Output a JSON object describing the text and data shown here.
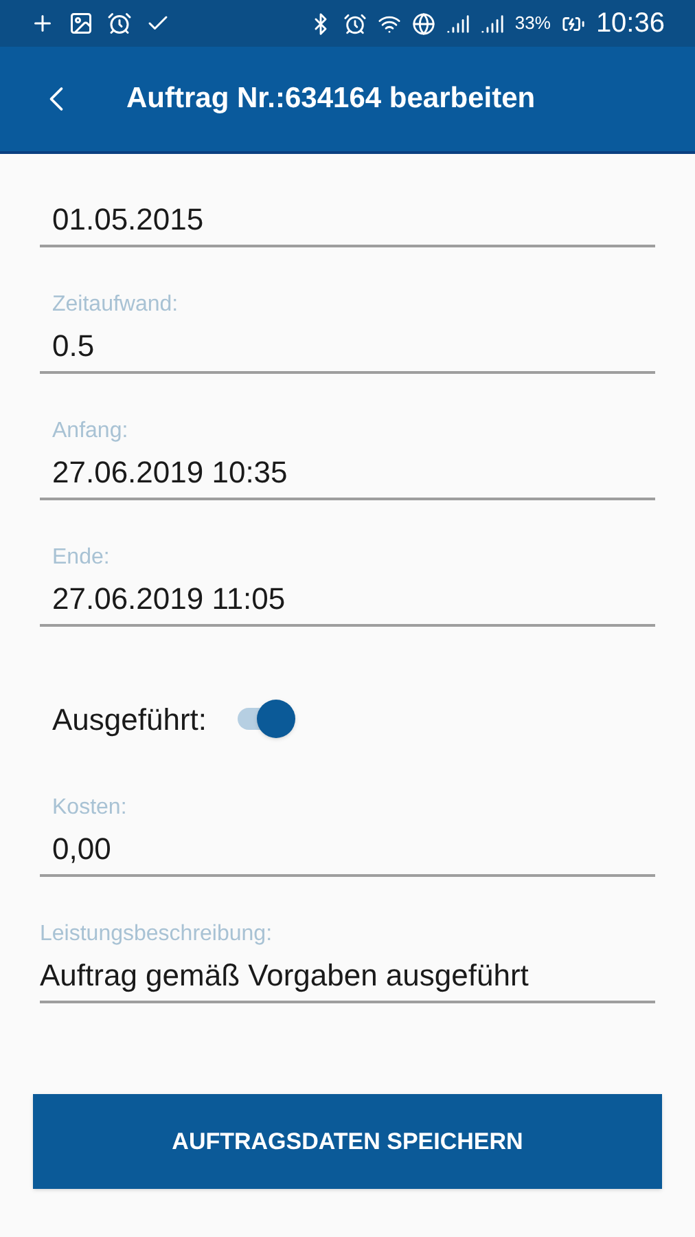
{
  "status_bar": {
    "battery": "33%",
    "time": "10:36"
  },
  "header": {
    "title": "Auftrag Nr.:634164 bearbeiten"
  },
  "form": [
    {
      "kind": "field",
      "value": "01.05.2015",
      "wide": false
    },
    {
      "kind": "field",
      "label": "Zeitaufwand:",
      "value": "0.5",
      "wide": false
    },
    {
      "kind": "field",
      "label": "Anfang:",
      "value": "27.06.2019 10:35",
      "wide": false
    },
    {
      "kind": "field",
      "label": "Ende:",
      "value": "27.06.2019 11:05",
      "wide": false
    },
    {
      "kind": "switch",
      "label": "Ausgeführt:",
      "on": true
    },
    {
      "kind": "field",
      "label": "Kosten:",
      "value": "0,00",
      "wide": false
    },
    {
      "kind": "field",
      "label": "Leistungsbeschreibung:",
      "value": "Auftrag gemäß Vorgaben ausgeführt",
      "wide": true
    }
  ],
  "save_button": "AUFTRAGSDATEN SPEICHERN"
}
